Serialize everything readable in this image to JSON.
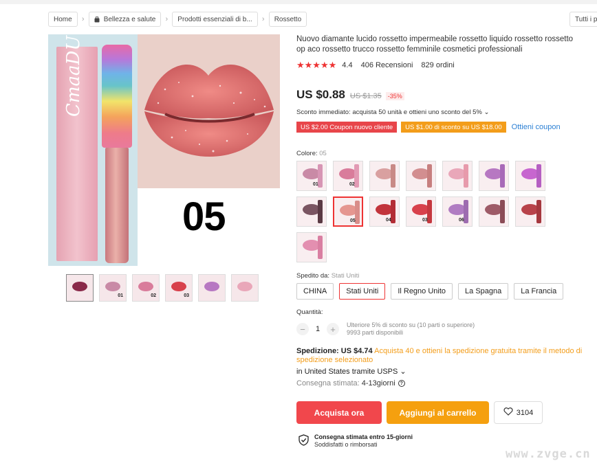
{
  "breadcrumb": {
    "home": "Home",
    "items": [
      "Bellezza e salute",
      "Prodotti essenziali di b...",
      "Rossetto"
    ],
    "all_categories": "Tutti i p"
  },
  "gallery": {
    "main_number": "05",
    "box_brand": "CmaaDU",
    "thumbs": [
      "",
      "01",
      "02",
      "03",
      "",
      ""
    ]
  },
  "product": {
    "title": "Nuovo diamante lucido rossetto impermeabile rossetto liquido rossetto rossetto op aco rossetto trucco rossetto femminile cosmetici professionali",
    "rating": "4.4",
    "reviews": "406 Recensioni",
    "orders": "829 ordini",
    "price": "US $0.88",
    "old_price": "US $1.35",
    "discount": "-35%",
    "instant_discount": "Sconto immediato: acquista 50 unità e ottieni uno sconto del 5%",
    "coupons": [
      "US $2.00 Coupon nuovo cliente",
      "US $1.00 di sconto su US $18.00"
    ],
    "get_coupon": "Ottieni coupon"
  },
  "color": {
    "label": "Colore:",
    "value": "05",
    "swatches": [
      {
        "n": "01",
        "lip": "#c98aa6",
        "tube": "#d795b4"
      },
      {
        "n": "02",
        "lip": "#d97c9b",
        "tube": "#e29ab4"
      },
      {
        "n": "",
        "lip": "#d9a0a0",
        "tube": "#c88a86"
      },
      {
        "n": "",
        "lip": "#d28e90",
        "tube": "#c77f7f"
      },
      {
        "n": "",
        "lip": "#e9a7b9",
        "tube": "#e79aab"
      },
      {
        "n": "",
        "lip": "#b778c2",
        "tube": "#a86ab8"
      },
      {
        "n": "",
        "lip": "#c766cf",
        "tube": "#b55fc2"
      },
      {
        "n": "",
        "lip": "#7a5562",
        "tube": "#5a3a44"
      },
      {
        "n": "05",
        "lip": "#e59690",
        "tube": "#d98d8a"
      },
      {
        "n": "04",
        "lip": "#c2343c",
        "tube": "#b32d36"
      },
      {
        "n": "03",
        "lip": "#d8414c",
        "tube": "#c5383f"
      },
      {
        "n": "06",
        "lip": "#b07cc2",
        "tube": "#9e6cb0"
      },
      {
        "n": "",
        "lip": "#9e5b68",
        "tube": "#8b4c57"
      },
      {
        "n": "",
        "lip": "#b8424a",
        "tube": "#a5373e"
      },
      {
        "n": "",
        "lip": "#e38fb0",
        "tube": "#d97fa2"
      }
    ]
  },
  "shipping_from": {
    "label": "Spedito da:",
    "value": "Stati Uniti",
    "options": [
      "CHINA",
      "Stati Uniti",
      "Il Regno Unito",
      "La Spagna",
      "La Francia"
    ],
    "selected": "Stati Uniti"
  },
  "quantity": {
    "label": "Quantità:",
    "value": "1",
    "minus": "−",
    "plus": "+",
    "bulk_note": "Ulteriore 5% di sconto su (10 parti o superiore)",
    "available": "9993 parti disponibili"
  },
  "shipping": {
    "label": "Spedizione:",
    "cost": "US $4.74",
    "promo": "Acquista 40 e ottieni la spedizione gratuita tramite il metodo di spedizione selezionato",
    "via": "in United States tramite USPS",
    "eta_label": "Consegna stimata:",
    "eta_value": "4-13giorni"
  },
  "actions": {
    "buy": "Acquista ora",
    "cart": "Aggiungi al carrello",
    "wishlist_count": "3104"
  },
  "guarantee": {
    "line1": "Consegna stimata entro 15-giorni",
    "line2": "Soddisfatti o rimborsati"
  },
  "watermark": "www.zvge.cn",
  "colors": {
    "accent_red": "#f1474c",
    "accent_orange": "#f5a00f",
    "link_blue": "#2a7fd4"
  }
}
